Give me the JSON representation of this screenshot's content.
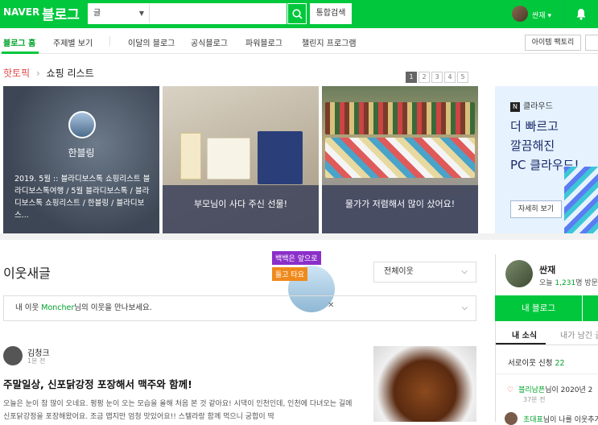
{
  "colors": {
    "brand": "#00c73c",
    "link": "#00a32a",
    "hot": "#e24b4b"
  },
  "header": {
    "logo_naver": "NAVER",
    "logo_blog": "블로그",
    "search_category": "글",
    "search_placeholder": "",
    "total_search_label": "통합검색",
    "username": "싼재",
    "user_caret": "▾"
  },
  "subnav": {
    "items": [
      {
        "label": "블로그 홈"
      },
      {
        "label": "주제별 보기"
      },
      {
        "label": "이달의 블로그"
      },
      {
        "label": "공식블로그"
      },
      {
        "label": "파워블로그"
      },
      {
        "label": "챌린지 프로그램"
      }
    ],
    "item_factory_label": "아이템 팩토리"
  },
  "hot_topic": {
    "label": "핫토픽",
    "chevron": "›",
    "subtitle": "쇼핑 리스트",
    "pages": [
      "1",
      "2",
      "3",
      "4",
      "5"
    ],
    "current_page": "1",
    "cards": [
      {
        "name": "한블링",
        "desc": "2019. 5월 :: 블라디보스톡 쇼핑리스트 블라디보스톡여행 / 5월 블라디보스톡 / 블라디보스톡 쇼핑리스트 / 한블링 / 블라디보스..."
      },
      {
        "text": "부모님이 사다 주신 선물!"
      },
      {
        "text": "물가가 저렴해서 많이 샀어요!"
      }
    ]
  },
  "ad": {
    "brand_icon": "N",
    "brand": "클라우드",
    "headline_1": "더 빠르고",
    "headline_2": "깔끔해진",
    "headline_3": "PC 클라우드!",
    "more_label": "자세히 보기"
  },
  "neighbors": {
    "title": "이웃새글",
    "promo_line1": "백백은 앞으로",
    "promo_line2": "들고 타요",
    "promo_close": "✕",
    "filter_value": "전체이웃",
    "notice_prefix": "내 이웃 ",
    "notice_name": "Moncher",
    "notice_suffix": "님의 이웃을 만나보세요.",
    "post": {
      "author": "김청크",
      "time": "1분 전",
      "title": "주말일상, 신포닭강정 포장해서 맥주와 함께!",
      "body": "오늘은 눈이 참 많이 오네요. 펑펑 눈이 오는 모습을 올해 처음 본 것 같아요! 시댁이 인천인데, 인천에 다녀오는 길에 신포닭강정을 포장해왔어요. 조금 맵지만 엄청 맛있어요!! 스텔라랑 함께 먹으니 궁합이 딱"
    }
  },
  "profile": {
    "name": "싼재",
    "visit_prefix": "오늘 ",
    "visit_count": "1,231",
    "visit_suffix": "명 방문",
    "my_blog_label": "내 블로그",
    "tab_news": "내 소식",
    "tab_comments": "내가 남긴 글",
    "request_label": "서로이웃 신청 ",
    "request_count": "22",
    "notif1_name": "블리남픈",
    "notif1_text": "님이 2020년 2",
    "notif1_time": "37분 전",
    "notif2_name": "초대표",
    "notif2_text": "님이 나를 이웃추가"
  }
}
